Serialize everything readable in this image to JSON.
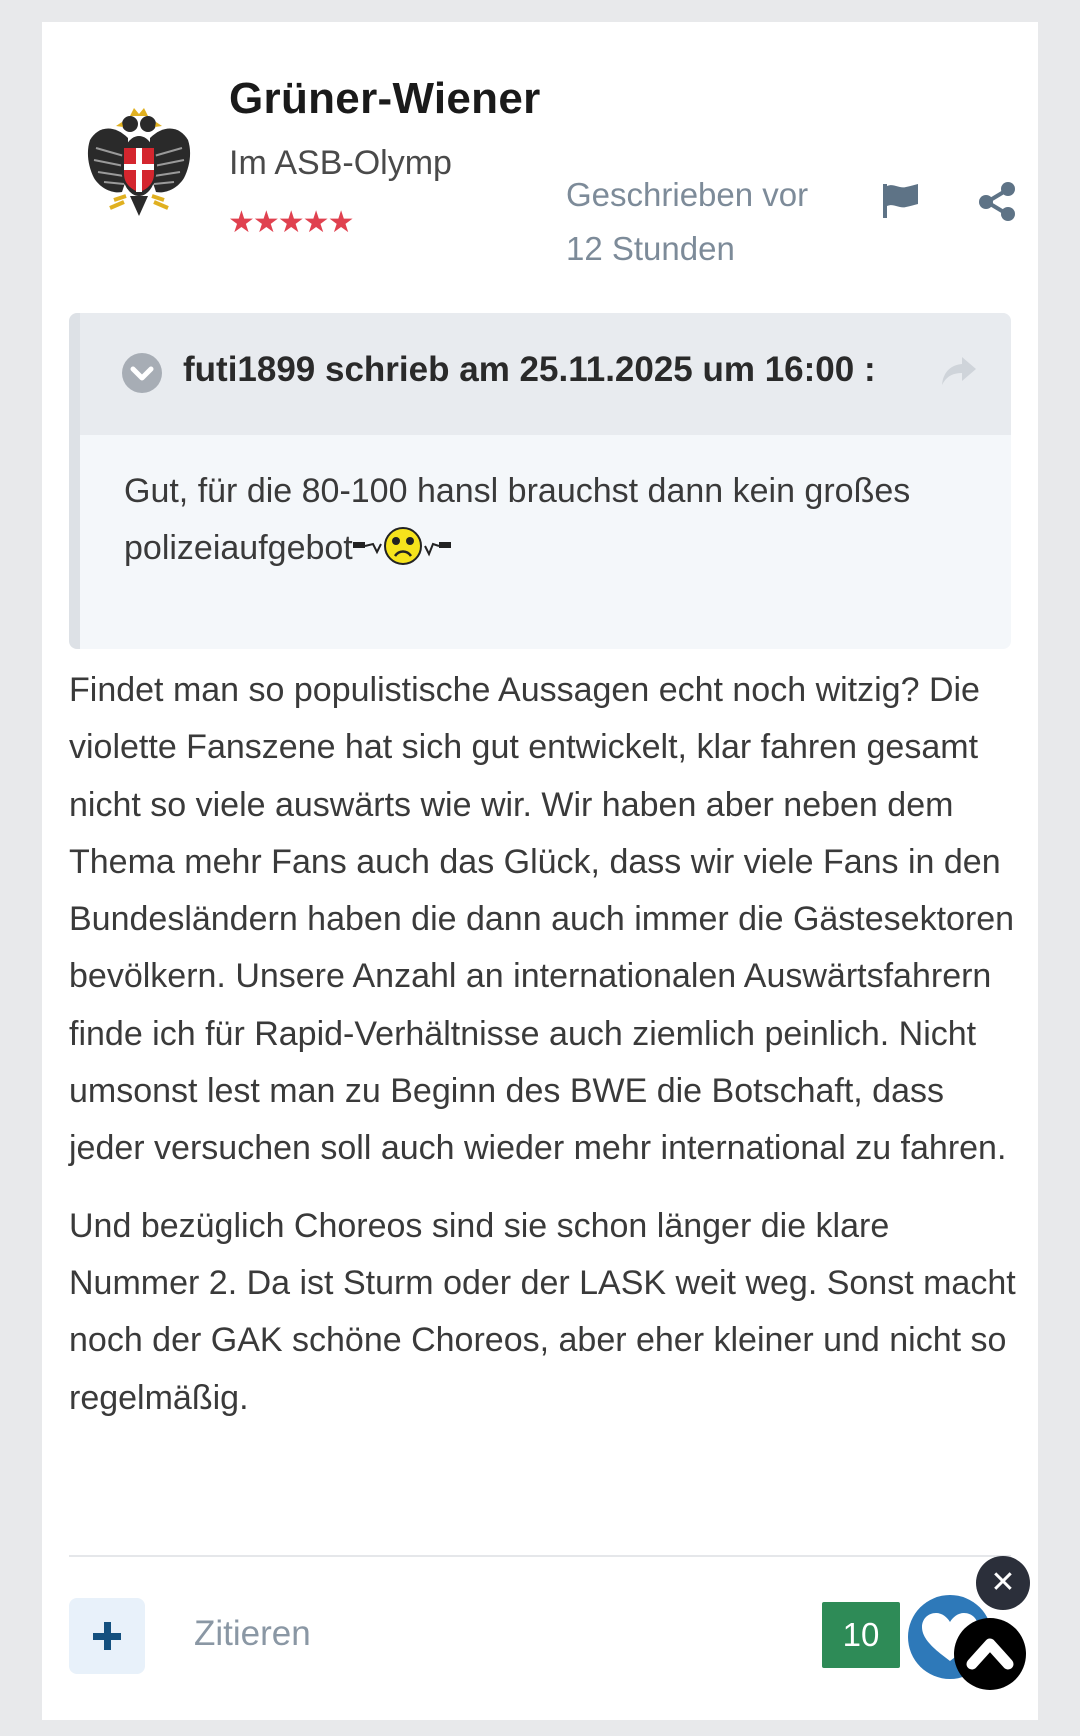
{
  "author": {
    "name": "Grüner-Wiener",
    "rank": "Im ASB-Olymp",
    "stars": "★★★★★",
    "avatar_icon": "vienna-eagle-crest-icon"
  },
  "post": {
    "date_line1": "Geschrieben vor",
    "date_line2": "12 Stunden",
    "actions": {
      "report_icon": "flag-icon",
      "share_icon": "share-icon"
    }
  },
  "quote": {
    "citation": "futi1899 schrieb am 25.11.2025 um 16:00 :",
    "text": "Gut, für die 80-100 hansl brauchst dann kein großes polizeiaufgebot",
    "emoji_icon": "sad-smiley-emoji-icon"
  },
  "body": {
    "paragraph1": "Findet man so populistische Aussagen echt noch witzig? Die violette Fanszene hat sich gut entwickelt, klar fahren gesamt nicht so viele auswärts wie wir. Wir haben aber neben dem Thema mehr Fans auch das Glück, dass wir viele Fans in den Bundesländern haben die dann auch immer die Gästesektoren bevölkern. Unsere Anzahl an internationalen Auswärtsfahrern finde ich für Rapid-Verhältnisse auch ziemlich peinlich. Nicht umsonst lest man zu Beginn des BWE die Botschaft, dass jeder versuchen soll auch wieder mehr international zu fahren.",
    "paragraph2": "Und bezüglich Choreos sind sie schon länger die klare Nummer 2. Da ist Sturm oder der LASK weit weg. Sonst macht noch der GAK schöne Choreos, aber eher kleiner und nicht so regelmäßig."
  },
  "footer": {
    "quote_label": "Zitieren",
    "reaction_count": "10",
    "close_label": "✕",
    "colors": {
      "reaction_count_bg": "#2e8b57",
      "reaction_button_bg": "#2e79b9"
    }
  }
}
